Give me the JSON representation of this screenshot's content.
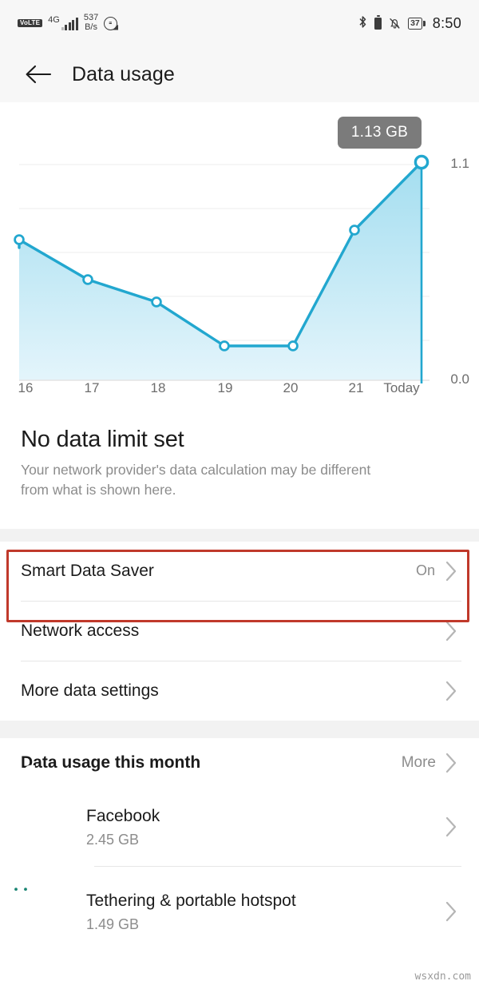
{
  "status_bar": {
    "volte_label": "VoLTE",
    "network_type": "4G",
    "data_speed_value": "537",
    "data_speed_unit": "B/s",
    "nfc_icon": "nfc-icon",
    "bluetooth_icon": "bluetooth-icon",
    "battery_small_icon": "battery-icon",
    "mute_icon": "bell-muted-icon",
    "battery_percent": "37",
    "time": "8:50"
  },
  "appbar": {
    "back_icon": "back-arrow-icon",
    "title": "Data usage"
  },
  "chart_data": {
    "type": "area",
    "title": "Data usage",
    "tooltip_label": "1.13 GB",
    "categories": [
      "16",
      "17",
      "18",
      "19",
      "20",
      "21",
      "Today"
    ],
    "values": [
      0.62,
      0.5,
      0.42,
      0.22,
      0.22,
      0.8,
      1.13
    ],
    "xlabel": "",
    "ylabel": "",
    "ylim": [
      0.0,
      1.1
    ],
    "ytick_labels": [
      "1.1",
      "0.0"
    ],
    "grid": true,
    "legend": "none",
    "line_color": "#22a7cf",
    "fill_color": "#bfe7f4",
    "point_fill": "#ffffff",
    "highlight_index": 6
  },
  "headline": {
    "title": "No data limit set",
    "subtitle": "Your network provider's data calculation may be different from what is shown here."
  },
  "settings_rows": [
    {
      "label": "Smart Data Saver",
      "value": "On",
      "chevron_icon": "chevron-right-icon",
      "highlighted": true
    },
    {
      "label": "Network access",
      "value": "",
      "chevron_icon": "chevron-right-icon",
      "highlighted": false
    },
    {
      "label": "More data settings",
      "value": "",
      "chevron_icon": "chevron-right-icon",
      "highlighted": false
    }
  ],
  "this_month": {
    "header": "Data usage this month",
    "more_label": "More",
    "more_chevron_icon": "chevron-right-icon",
    "apps": [
      {
        "name": "Facebook",
        "size": "2.45 GB",
        "icon": "facebook-icon",
        "chevron_icon": "chevron-right-icon"
      },
      {
        "name": "Tethering & portable hotspot",
        "size": "1.49 GB",
        "icon": "android-tethering-icon",
        "chevron_icon": "chevron-right-icon"
      }
    ]
  },
  "watermark": "wsxdn.com",
  "colors": {
    "accent": "#22a7cf",
    "highlight_border": "#c0392b",
    "tooltip_bg": "#7b7b7b",
    "facebook_blue": "#1877f2",
    "android_teal": "#1a8573"
  }
}
